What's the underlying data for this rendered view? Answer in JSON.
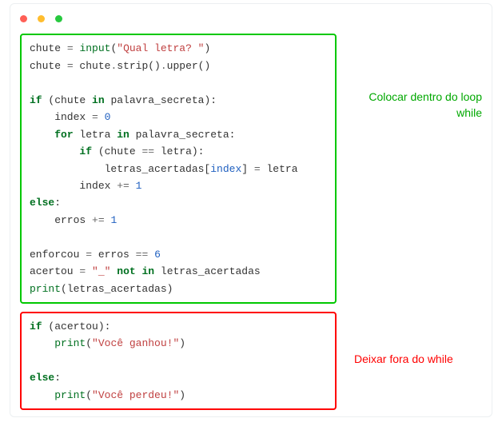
{
  "dots": [
    {
      "color": "#ff5f56"
    },
    {
      "color": "#ffbd2e"
    },
    {
      "color": "#27c93f"
    }
  ],
  "green_block": {
    "tokens": [
      {
        "t": "nm",
        "v": "chute "
      },
      {
        "t": "op",
        "v": "="
      },
      {
        "t": "nm",
        "v": " "
      },
      {
        "t": "bi",
        "v": "input"
      },
      {
        "t": "nm",
        "v": "("
      },
      {
        "t": "str",
        "v": "\"Qual letra? \""
      },
      {
        "t": "nm",
        "v": ")"
      },
      {
        "br": 1
      },
      {
        "t": "nm",
        "v": "chute "
      },
      {
        "t": "op",
        "v": "="
      },
      {
        "t": "nm",
        "v": " chute"
      },
      {
        "t": "op",
        "v": "."
      },
      {
        "t": "nm",
        "v": "strip()"
      },
      {
        "t": "op",
        "v": "."
      },
      {
        "t": "nm",
        "v": "upper()"
      },
      {
        "br": 1
      },
      {
        "br": 1
      },
      {
        "t": "kw",
        "v": "if"
      },
      {
        "t": "nm",
        "v": " (chute "
      },
      {
        "t": "kw",
        "v": "in"
      },
      {
        "t": "nm",
        "v": " palavra_secreta):"
      },
      {
        "br": 1
      },
      {
        "t": "nm",
        "v": "    index "
      },
      {
        "t": "op",
        "v": "="
      },
      {
        "t": "nm",
        "v": " "
      },
      {
        "t": "num",
        "v": "0"
      },
      {
        "br": 1
      },
      {
        "t": "nm",
        "v": "    "
      },
      {
        "t": "kw",
        "v": "for"
      },
      {
        "t": "nm",
        "v": " letra "
      },
      {
        "t": "kw",
        "v": "in"
      },
      {
        "t": "nm",
        "v": " palavra_secreta:"
      },
      {
        "br": 1
      },
      {
        "t": "nm",
        "v": "        "
      },
      {
        "t": "kw",
        "v": "if"
      },
      {
        "t": "nm",
        "v": " (chute "
      },
      {
        "t": "op",
        "v": "=="
      },
      {
        "t": "nm",
        "v": " letra):"
      },
      {
        "br": 1
      },
      {
        "t": "nm",
        "v": "            letras_acertadas["
      },
      {
        "t": "idx",
        "v": "index"
      },
      {
        "t": "nm",
        "v": "] "
      },
      {
        "t": "op",
        "v": "="
      },
      {
        "t": "nm",
        "v": " letra"
      },
      {
        "br": 1
      },
      {
        "t": "nm",
        "v": "        index "
      },
      {
        "t": "op",
        "v": "+="
      },
      {
        "t": "nm",
        "v": " "
      },
      {
        "t": "num",
        "v": "1"
      },
      {
        "br": 1
      },
      {
        "t": "kw",
        "v": "else"
      },
      {
        "t": "nm",
        "v": ":"
      },
      {
        "br": 1
      },
      {
        "t": "nm",
        "v": "    erros "
      },
      {
        "t": "op",
        "v": "+="
      },
      {
        "t": "nm",
        "v": " "
      },
      {
        "t": "num",
        "v": "1"
      },
      {
        "br": 1
      },
      {
        "br": 1
      },
      {
        "t": "nm",
        "v": "enforcou "
      },
      {
        "t": "op",
        "v": "="
      },
      {
        "t": "nm",
        "v": " erros "
      },
      {
        "t": "op",
        "v": "=="
      },
      {
        "t": "nm",
        "v": " "
      },
      {
        "t": "num",
        "v": "6"
      },
      {
        "br": 1
      },
      {
        "t": "nm",
        "v": "acertou "
      },
      {
        "t": "op",
        "v": "="
      },
      {
        "t": "nm",
        "v": " "
      },
      {
        "t": "str",
        "v": "\"_\""
      },
      {
        "t": "nm",
        "v": " "
      },
      {
        "t": "kw",
        "v": "not"
      },
      {
        "t": "nm",
        "v": " "
      },
      {
        "t": "kw",
        "v": "in"
      },
      {
        "t": "nm",
        "v": " letras_acertadas"
      },
      {
        "br": 1
      },
      {
        "t": "bi",
        "v": "print"
      },
      {
        "t": "nm",
        "v": "(letras_acertadas)"
      }
    ]
  },
  "red_block": {
    "tokens": [
      {
        "t": "kw",
        "v": "if"
      },
      {
        "t": "nm",
        "v": " (acertou):"
      },
      {
        "br": 1
      },
      {
        "t": "nm",
        "v": "    "
      },
      {
        "t": "bi",
        "v": "print"
      },
      {
        "t": "nm",
        "v": "("
      },
      {
        "t": "str",
        "v": "\"Você ganhou!\""
      },
      {
        "t": "nm",
        "v": ")"
      },
      {
        "br": 1
      },
      {
        "br": 1
      },
      {
        "t": "kw",
        "v": "else"
      },
      {
        "t": "nm",
        "v": ":"
      },
      {
        "br": 1
      },
      {
        "t": "nm",
        "v": "    "
      },
      {
        "t": "bi",
        "v": "print"
      },
      {
        "t": "nm",
        "v": "("
      },
      {
        "t": "str",
        "v": "\"Você perdeu!\""
      },
      {
        "t": "nm",
        "v": ")"
      }
    ]
  },
  "notes": {
    "green": "Colocar dentro do loop while",
    "red": "Deixar fora do while"
  }
}
